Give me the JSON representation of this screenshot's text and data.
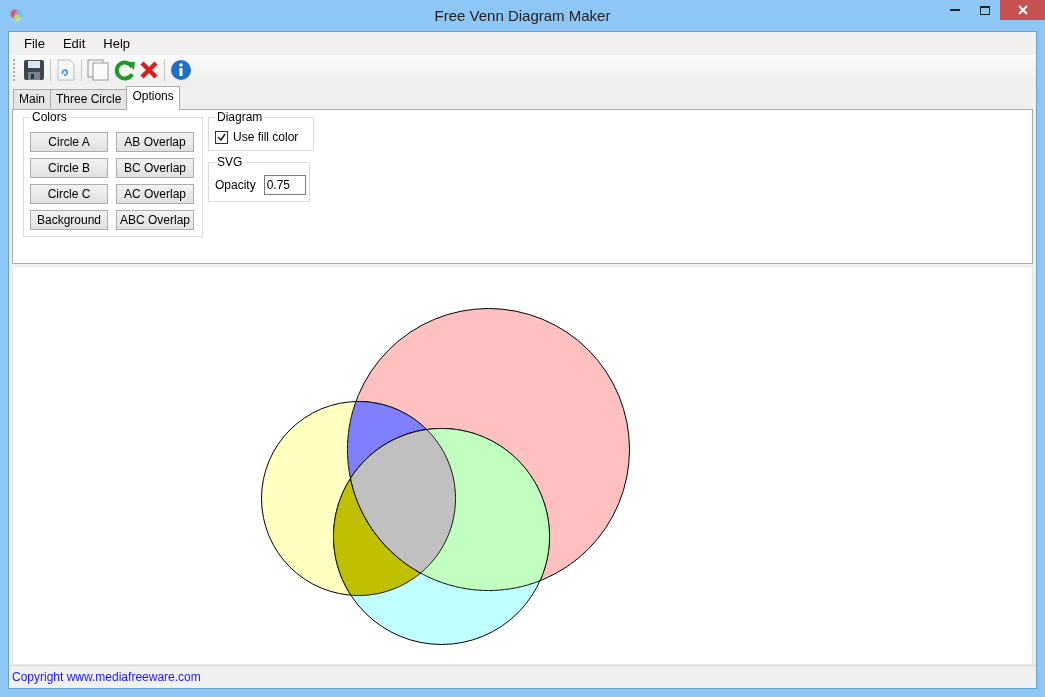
{
  "window": {
    "title": "Free Venn Diagram Maker"
  },
  "menu": [
    "File",
    "Edit",
    "Help"
  ],
  "toolbar": [
    {
      "kind": "save"
    },
    {
      "kind": "sep"
    },
    {
      "kind": "doc"
    },
    {
      "kind": "sep"
    },
    {
      "kind": "copy"
    },
    {
      "kind": "refresh"
    },
    {
      "kind": "delete"
    },
    {
      "kind": "sep"
    },
    {
      "kind": "info"
    }
  ],
  "tabs": [
    {
      "label": "Main",
      "selected": false
    },
    {
      "label": "Three Circle",
      "selected": false
    },
    {
      "label": "Options",
      "selected": true
    }
  ],
  "colors_group": {
    "title": "Colors",
    "buttons": [
      "Circle A",
      "AB Overlap",
      "Circle B",
      "BC Overlap",
      "Circle C",
      "AC Overlap",
      "Background",
      "ABC Overlap"
    ]
  },
  "diagram_group": {
    "title": "Diagram",
    "use_fill_color": {
      "label": "Use fill color",
      "checked": true
    }
  },
  "svg_group": {
    "title": "SVG",
    "opacity": {
      "label": "Opacity",
      "value": "0.75"
    }
  },
  "status_bar": "Copyright www.mediafreeware.com"
}
